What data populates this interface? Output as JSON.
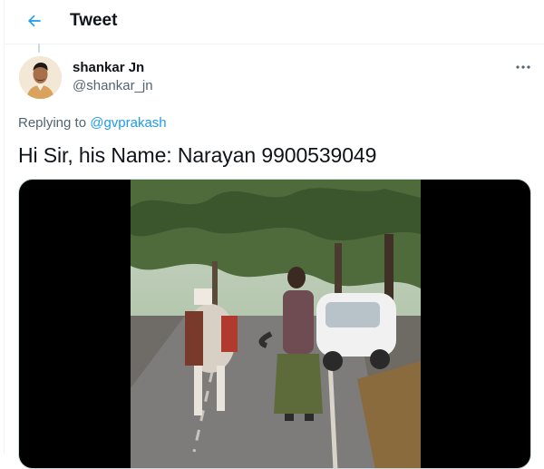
{
  "header": {
    "back_icon": "arrow-left-icon",
    "title": "Tweet"
  },
  "tweet": {
    "author": {
      "display_name": "shankar Jn",
      "handle": "@shankar_jn",
      "avatar_icon": "profile-photo"
    },
    "more_icon": "more-horizontal-icon",
    "replying_prefix": "Replying to",
    "replying_to": "@gvprakash",
    "text": "Hi Sir, his Name: Narayan 9900539049",
    "media": {
      "type": "video",
      "description_icon": "video-thumbnail"
    }
  },
  "colors": {
    "accent": "#1d9bf0",
    "text_primary": "#0f1419",
    "text_secondary": "#536471",
    "divider": "#eff3f4"
  }
}
